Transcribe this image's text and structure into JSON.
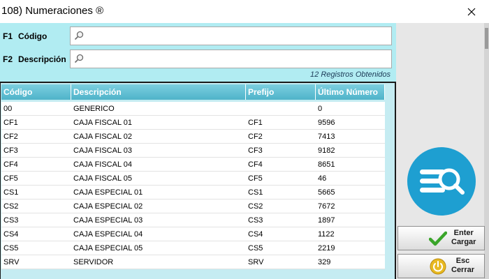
{
  "window": {
    "title": "108) Numeraciones ®",
    "close_icon": "close-icon"
  },
  "search": {
    "codigo_key": "F1",
    "codigo_label": "Código",
    "codigo_value": "",
    "descripcion_key": "F2",
    "descripcion_label": "Descripción",
    "descripcion_value": "",
    "records_text": "12 Registros Obtenidos",
    "icon": "magnifier-icon"
  },
  "grid": {
    "columns": [
      "Código",
      "Descripción",
      "Prefijo",
      "Último Número"
    ],
    "rows": [
      [
        "00",
        "GENERICO",
        "",
        "0"
      ],
      [
        "CF1",
        "CAJA FISCAL 01",
        "CF1",
        "9596"
      ],
      [
        "CF2",
        "CAJA FISCAL 02",
        "CF2",
        "7413"
      ],
      [
        "CF3",
        "CAJA FISCAL 03",
        "CF3",
        "9182"
      ],
      [
        "CF4",
        "CAJA FISCAL 04",
        "CF4",
        "8651"
      ],
      [
        "CF5",
        "CAJA FISCAL 05",
        "CF5",
        "46"
      ],
      [
        "CS1",
        "CAJA ESPECIAL 01",
        "CS1",
        "5665"
      ],
      [
        "CS2",
        "CAJA ESPECIAL 02",
        "CS2",
        "7672"
      ],
      [
        "CS3",
        "CAJA ESPECIAL 03",
        "CS3",
        "1897"
      ],
      [
        "CS4",
        "CAJA ESPECIAL 04",
        "CS4",
        "1122"
      ],
      [
        "CS5",
        "CAJA ESPECIAL 05",
        "CS5",
        "2219"
      ],
      [
        "SRV",
        "SERVIDOR",
        "SRV",
        "329"
      ]
    ]
  },
  "actions": {
    "cargar_key": "Enter",
    "cargar_label": "Cargar",
    "cargar_icon": "checkmark-icon",
    "cerrar_key": "Esc",
    "cerrar_label": "Cerrar",
    "cerrar_icon": "power-icon"
  },
  "logo": {
    "icon": "list-search-icon"
  },
  "colors": {
    "panel": "#b1ecf2",
    "header": "#4fb3c9",
    "logo": "#1e9fd1"
  }
}
